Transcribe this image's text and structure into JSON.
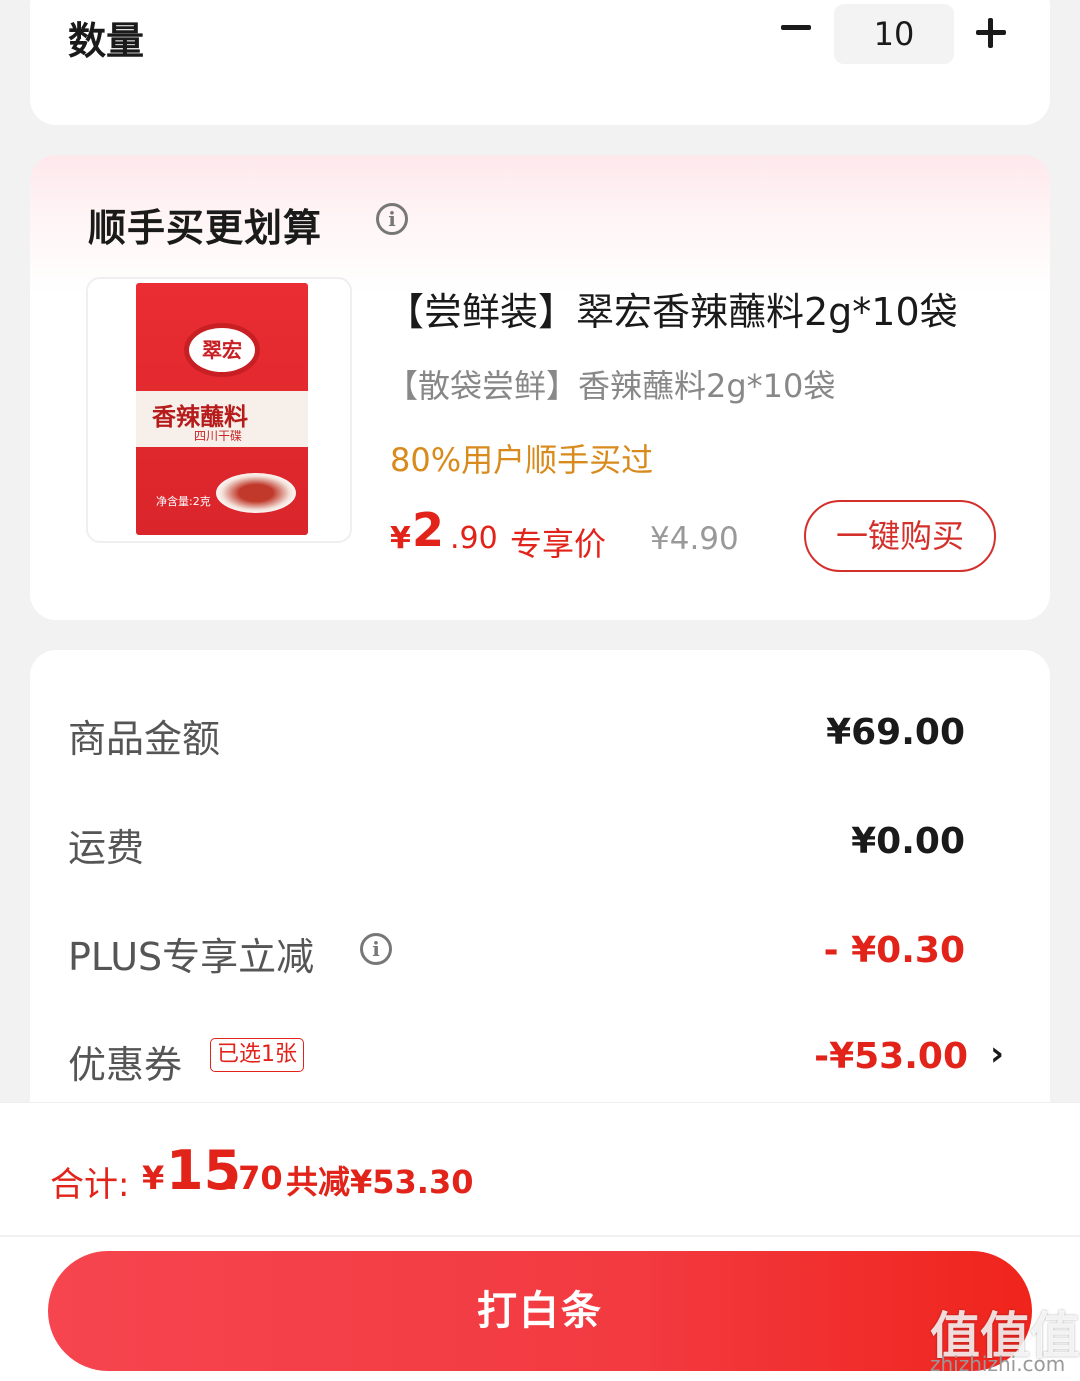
{
  "quantity": {
    "label": "数量",
    "value": "10",
    "minus_icon": "minus-icon",
    "plus_icon": "plus-icon"
  },
  "recommend": {
    "title": "顺手买更划算",
    "product": {
      "title": "【尝鲜装】翠宏香辣蘸料2g*10袋",
      "subtitle": "【散袋尝鲜】香辣蘸料2g*10袋",
      "note": "80%用户顺手买过",
      "price_currency": "¥",
      "price_int": "2",
      "price_dec": ".90",
      "price_tag": "专享价",
      "original_price": "¥4.90",
      "buy_label": "一键购买",
      "image_text": {
        "brand": "翠宏",
        "name": "香辣蘸料",
        "sub": "四川干碟",
        "net": "净含量:2克"
      }
    }
  },
  "summary": {
    "rows": [
      {
        "label": "商品金额",
        "value": "¥69.00"
      },
      {
        "label": "运费",
        "value": "¥0.00"
      },
      {
        "label": "PLUS专享立减",
        "value": "- ¥0.30"
      },
      {
        "label": "优惠券",
        "badge": "已选1张",
        "value": "-¥53.00"
      }
    ],
    "accent_color": "#e2231a"
  },
  "bottom": {
    "total_label": "合计:",
    "total_currency": "¥",
    "total_int": "15",
    "total_dec": ".70",
    "saved": "共减¥53.30",
    "pay_label": "打白条"
  },
  "watermark": {
    "logo": "值值值",
    "domain": "zhizhizhi.com"
  }
}
